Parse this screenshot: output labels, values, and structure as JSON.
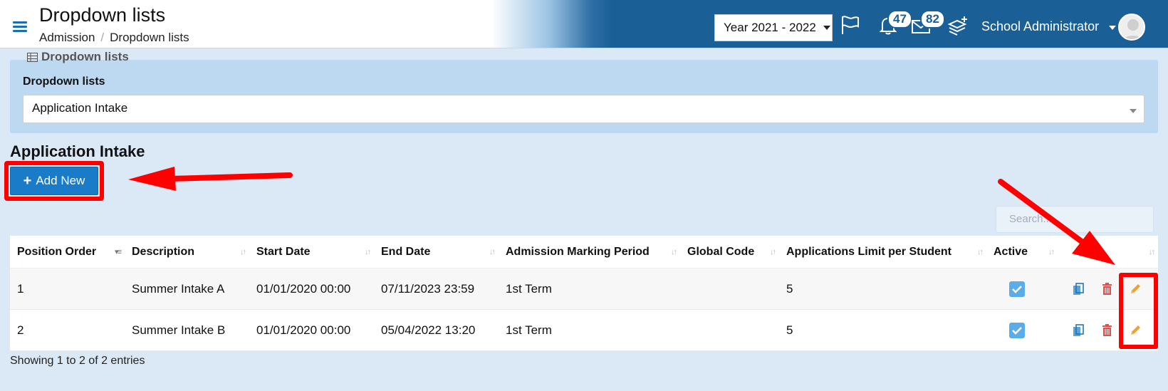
{
  "header": {
    "title": "Dropdown lists",
    "breadcrumb": [
      "Admission",
      "Dropdown lists"
    ],
    "year_selector": "Year 2021 - 2022",
    "notifications_count": "47",
    "messages_count": "82",
    "user_name": "School Administrator"
  },
  "filter_panel": {
    "legend": "Dropdown lists",
    "label": "Dropdown lists",
    "selected_value": "Application Intake"
  },
  "section_title": "Application Intake",
  "add_button_label": "Add New",
  "search_placeholder": "Search...",
  "table": {
    "columns": [
      "Position Order",
      "Description",
      "Start Date",
      "End Date",
      "Admission Marking Period",
      "Global Code",
      "Applications Limit per Student",
      "Active",
      ""
    ],
    "rows": [
      {
        "position_order": "1",
        "description": "Summer Intake A",
        "start_date": "01/01/2020 00:00",
        "end_date": "07/11/2023 23:59",
        "marking_period": "1st Term",
        "global_code": "",
        "limit": "5",
        "active": true
      },
      {
        "position_order": "2",
        "description": "Summer Intake B",
        "start_date": "01/01/2020 00:00",
        "end_date": "05/04/2022 13:20",
        "marking_period": "1st Term",
        "global_code": "",
        "limit": "5",
        "active": true
      }
    ]
  },
  "footer_info": "Showing 1 to 2 of 2 entries",
  "colors": {
    "header_blue": "#1a5f96",
    "button_blue": "#1a7cc8",
    "highlight_red": "#ff0000",
    "panel_blue": "#bcd9f1",
    "edit_orange": "#f0a030",
    "delete_red": "#d9534f"
  },
  "icons": [
    "menu-icon",
    "flag-icon",
    "bell-icon",
    "envelope-icon",
    "layers-add-icon",
    "table-icon",
    "copy-icon",
    "trash-icon",
    "pencil-icon",
    "check-icon"
  ]
}
